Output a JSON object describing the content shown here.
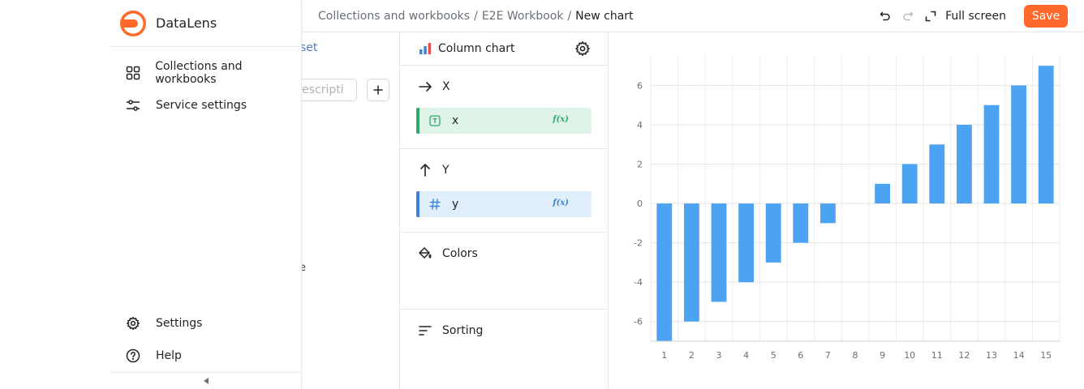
{
  "app": {
    "name": "DataLens"
  },
  "header": {
    "breadcrumbs": [
      "Collections and workbooks",
      "E2E Workbook"
    ],
    "separator": "/",
    "current": "New chart",
    "fullscreen_label": "Full screen",
    "save_label": "Save"
  },
  "sidebar": {
    "items": [
      {
        "label": "Collections and workbooks",
        "icon": "grid-icon"
      },
      {
        "label": "Service settings",
        "icon": "sliders-icon"
      }
    ],
    "bottom_items": [
      {
        "label": "Settings",
        "icon": "gear-icon"
      },
      {
        "label": "Help",
        "icon": "help-circle-icon"
      }
    ]
  },
  "dataset_panel": {
    "tab_fragment": "set",
    "search_placeholder": "r descripti",
    "text_fragment": "e"
  },
  "visualization": {
    "type_label": "Column chart",
    "sections": {
      "x": {
        "label": "X",
        "field": "x",
        "field_type": "text"
      },
      "y": {
        "label": "Y",
        "field": "y",
        "field_type": "number"
      },
      "colors": {
        "label": "Colors"
      },
      "sorting": {
        "label": "Sorting"
      }
    },
    "formula_badge": "f(x)"
  },
  "colors": {
    "accent": "#ff6a2b",
    "bar": "#4ba3f2",
    "dimension_green": "#2fa86a",
    "dimension_bg": "#e0f3e8",
    "measure_blue": "#3c83d6",
    "measure_bg": "#e1effc"
  },
  "chart_data": {
    "type": "bar",
    "categories": [
      "1",
      "2",
      "3",
      "4",
      "5",
      "6",
      "7",
      "8",
      "9",
      "10",
      "11",
      "12",
      "13",
      "14",
      "15"
    ],
    "values": [
      -7,
      -6,
      -5,
      -4,
      -3,
      -2,
      -1,
      0,
      1,
      2,
      3,
      4,
      5,
      6,
      7
    ],
    "y_ticks": [
      6,
      4,
      2,
      0,
      -2,
      -4,
      -6
    ],
    "ylim": [
      -7,
      7.5
    ],
    "grid": true
  }
}
